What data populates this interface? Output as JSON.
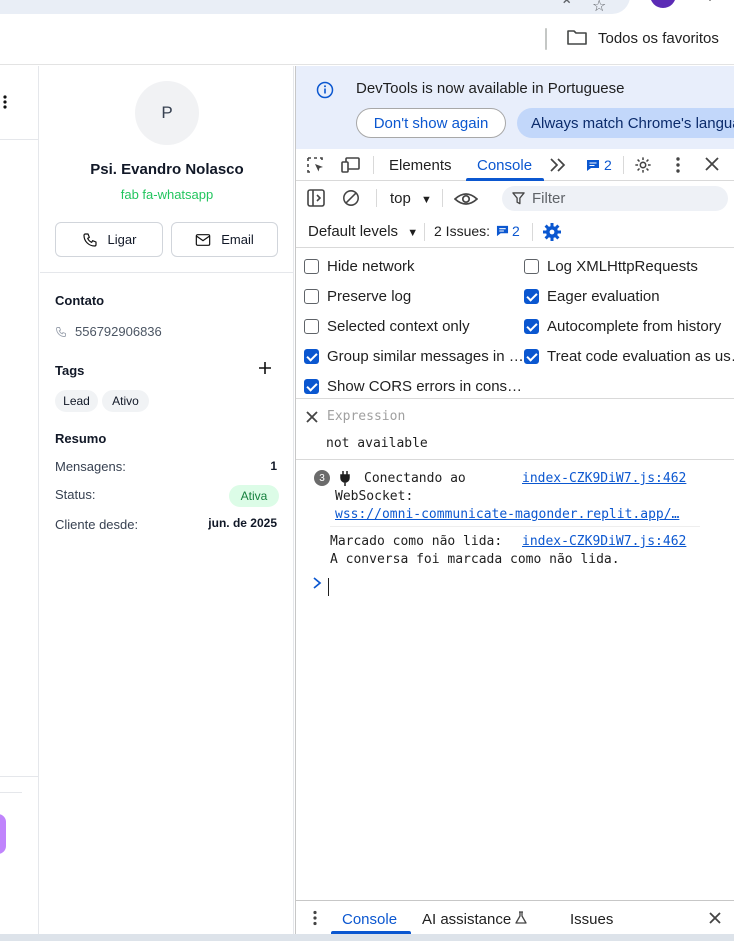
{
  "browser": {
    "bookmarks_folder_label": "Todos os favoritos"
  },
  "contact": {
    "avatar_initial": "P",
    "name": "Psi. Evandro Nolasco",
    "channel": "fab fa-whatsapp",
    "call_label": "Ligar",
    "email_label": "Email",
    "contact_title": "Contato",
    "phone": "556792906836",
    "tags_title": "Tags",
    "tags": [
      "Lead",
      "Ativo"
    ],
    "summary_title": "Resumo",
    "messages_label": "Mensagens:",
    "messages_value": "1",
    "status_label": "Status:",
    "status_value": "Ativa",
    "client_since_label": "Cliente desde:",
    "client_since_value": "jun. de 2025"
  },
  "devtools": {
    "info_text": "DevTools is now available in Portuguese",
    "dont_show_label": "Don't show again",
    "always_match_label": "Always match Chrome's language",
    "tabs": [
      "Elements",
      "Console"
    ],
    "message_count": "2",
    "context": "top",
    "filter_placeholder": "Filter",
    "default_levels": "Default levels",
    "issues_label": "2 Issues:",
    "issues_count": "2",
    "settings": {
      "hide_network": "Hide network",
      "log_xhr": "Log XMLHttpRequests",
      "preserve_log": "Preserve log",
      "eager_eval": "Eager evaluation",
      "selected_context": "Selected context only",
      "autocomplete": "Autocomplete from history",
      "group_similar": "Group similar messages in …",
      "treat_code": "Treat code evaluation as us…",
      "cors_errors": "Show CORS errors in cons…"
    },
    "expression_placeholder": "Expression",
    "expression_result": "not available",
    "log1": {
      "count": "3",
      "text_line1": "Conectando ao",
      "text_line2": "WebSocket:",
      "url": "wss://omni-communicate-magonder.replit.app/…",
      "source": "index-CZK9DiW7.js:462"
    },
    "log2": {
      "text_line1": "Marcado como não lida:",
      "text_line2": "A conversa foi marcada como não lida.",
      "source": "index-CZK9DiW7.js:462"
    },
    "drawer_tabs": [
      "Console",
      "AI assistance",
      "Issues"
    ]
  }
}
